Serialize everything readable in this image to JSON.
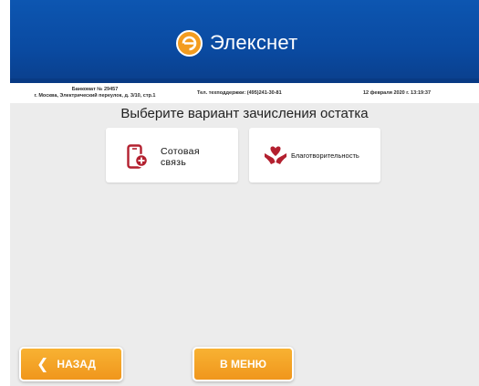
{
  "header": {
    "brand": "Элекснет",
    "logo_icon": "elecsnet-logo-icon",
    "brand_color": "#0d56b1",
    "accent_color": "#f39c1f"
  },
  "infobar": {
    "terminal_id": "Банкомат № 29457",
    "address": "г. Москва, Электрический переулок, д. 3/10, стр.1",
    "support": "Тел. техподдержки: (495)241-30-81",
    "datetime": "12 февраля 2020 г. 13:19:37"
  },
  "main": {
    "title": "Выберите вариант зачисления остатка",
    "options": [
      {
        "label_line1": "Сотовая",
        "label_line2": "связь",
        "icon": "mobile-phone-add-icon"
      },
      {
        "label": "Благотворительность",
        "icon": "heart-hands-icon"
      }
    ]
  },
  "footer": {
    "back_label": "НАЗАД",
    "back_icon": "chevron-left-icon",
    "menu_label": "В МЕНЮ"
  }
}
